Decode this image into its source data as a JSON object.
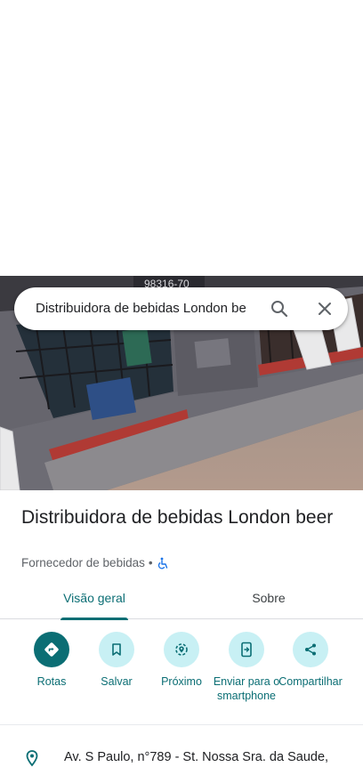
{
  "search": {
    "query": "Distribuidora de bebidas London be",
    "search_icon": "search-icon",
    "close_icon": "close-icon"
  },
  "place": {
    "name": "Distribuidora de bebidas London beer",
    "category": "Fornecedor de bebidas",
    "separator": "•",
    "accessibility_icon": "wheelchair-icon",
    "photo_sign_text": "98316-70"
  },
  "tabs": [
    {
      "label": "Visão geral",
      "active": true
    },
    {
      "label": "Sobre",
      "active": false
    }
  ],
  "actions": [
    {
      "label": "Rotas",
      "icon": "directions-icon",
      "primary": true
    },
    {
      "label": "Salvar",
      "icon": "bookmark-icon",
      "primary": false
    },
    {
      "label": "Próximo",
      "icon": "nearby-icon",
      "primary": false
    },
    {
      "label": "Enviar para o smartphone",
      "icon": "send-to-phone-icon",
      "primary": false
    },
    {
      "label": "Compartilhar",
      "icon": "share-icon",
      "primary": false
    }
  ],
  "address": {
    "icon": "location-pin-icon",
    "text": "Av. S Paulo, n°789 - St. Nossa Sra. da Saude,"
  },
  "colors": {
    "accent": "#0b6e74",
    "accent_light": "#c8f0f4",
    "text_primary": "#202124",
    "text_secondary": "#5f6368"
  }
}
